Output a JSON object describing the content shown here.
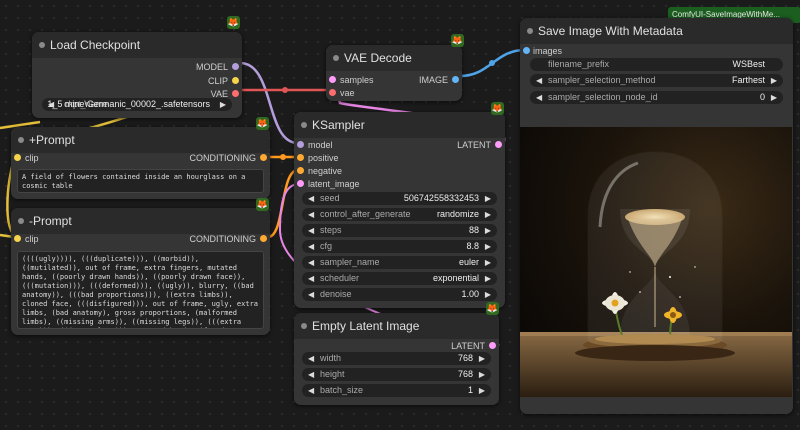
{
  "title_badge": "ComfyUI-SaveImageWithMe...",
  "load_checkpoint": {
    "title": "Load Checkpoint",
    "outputs": [
      "MODEL",
      "CLIP",
      "VAE"
    ],
    "ckpt_label": "ckpt_name",
    "ckpt_value": "1_5 mine\\Germanic_00002_.safetensors"
  },
  "vae_decode": {
    "title": "VAE Decode",
    "inputs": [
      "samples",
      "vae"
    ],
    "output": "IMAGE"
  },
  "save_image": {
    "title": "Save Image With Metadata",
    "input": "images",
    "widgets": [
      {
        "label": "filename_prefix",
        "value": "WSBest"
      },
      {
        "label": "sampler_selection_method",
        "value": "Farthest"
      },
      {
        "label": "sampler_selection_node_id",
        "value": "0"
      }
    ]
  },
  "positive_prompt": {
    "title": "+Prompt",
    "input": "clip",
    "output": "CONDITIONING",
    "text": "A field of flowers contained inside an hourglass on a cosmic table"
  },
  "negative_prompt": {
    "title": "-Prompt",
    "input": "clip",
    "output": "CONDITIONING",
    "text": "((((ugly)))), (((duplicate))), ((morbid)), ((mutilated)), out of frame, extra fingers, mutated hands, ((poorly drawn hands)), ((poorly drawn face)), (((mutation))), (((deformed))), ((ugly)), blurry, ((bad anatomy)), (((bad proportions))), ((extra limbs)), cloned face, (((disfigured))), out of frame, ugly, extra limbs, (bad anatomy), gross proportions, (malformed limbs), ((missing arms)), ((missing legs)), (((extra arms))), (((extra legs))), mutated hands, (fused fingers), (too many fingers), (((long neck)))"
  },
  "ksampler": {
    "title": "KSampler",
    "inputs": [
      "model",
      "positive",
      "negative",
      "latent_image"
    ],
    "output": "LATENT",
    "widgets": [
      {
        "label": "seed",
        "value": "506742558332453"
      },
      {
        "label": "control_after_generate",
        "value": "randomize"
      },
      {
        "label": "steps",
        "value": "88"
      },
      {
        "label": "cfg",
        "value": "8.8"
      },
      {
        "label": "sampler_name",
        "value": "euler"
      },
      {
        "label": "scheduler",
        "value": "exponential"
      },
      {
        "label": "denoise",
        "value": "1.00"
      }
    ]
  },
  "empty_latent": {
    "title": "Empty Latent Image",
    "output": "LATENT",
    "widgets": [
      {
        "label": "width",
        "value": "768"
      },
      {
        "label": "height",
        "value": "768"
      },
      {
        "label": "batch_size",
        "value": "1"
      }
    ]
  },
  "colors": {
    "model": "#b39ddb",
    "clip": "#f5d34a",
    "vae": "#ff6e6e",
    "conditioning": "#ffa931",
    "latent": "#ff9cf9",
    "image": "#64b5f6"
  },
  "icons": {
    "node_badge": "fox-icon"
  }
}
